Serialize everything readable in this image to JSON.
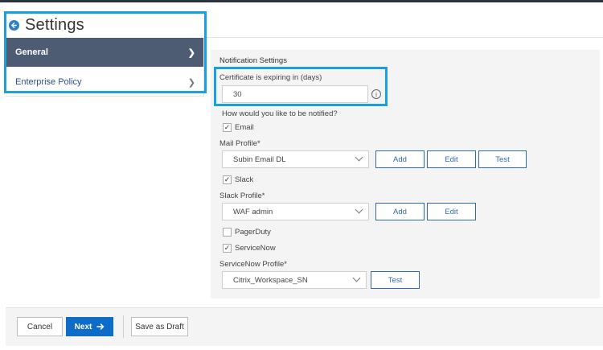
{
  "header": {
    "title": "Settings",
    "back_icon": "back-arrow-icon"
  },
  "nav": {
    "items": [
      {
        "label": "General",
        "active": true
      },
      {
        "label": "Enterprise Policy",
        "active": false
      }
    ]
  },
  "notification": {
    "section_title": "Notification Settings",
    "cert_label": "Certificate is expiring in (days)",
    "cert_value": "30",
    "notify_question": "How would you like to be notified?",
    "email_label": "Email",
    "email_checked": true,
    "mail_profile_label": "Mail Profile*",
    "mail_profile_value": "Subin Email DL",
    "slack_label": "Slack",
    "slack_checked": true,
    "slack_profile_label": "Slack Profile*",
    "slack_profile_value": "WAF admin",
    "pagerduty_label": "PagerDuty",
    "pagerduty_checked": false,
    "servicenow_label": "ServiceNow",
    "servicenow_checked": true,
    "servicenow_profile_label": "ServiceNow Profile*",
    "servicenow_profile_value": "Citrix_Workspace_SN"
  },
  "buttons": {
    "add": "Add",
    "edit": "Edit",
    "test": "Test"
  },
  "footer": {
    "cancel": "Cancel",
    "next": "Next",
    "save_draft": "Save as Draft"
  },
  "colors": {
    "accent": "#0d6cc7",
    "highlight": "#1a9fe0",
    "nav_active": "#4d5b73"
  }
}
